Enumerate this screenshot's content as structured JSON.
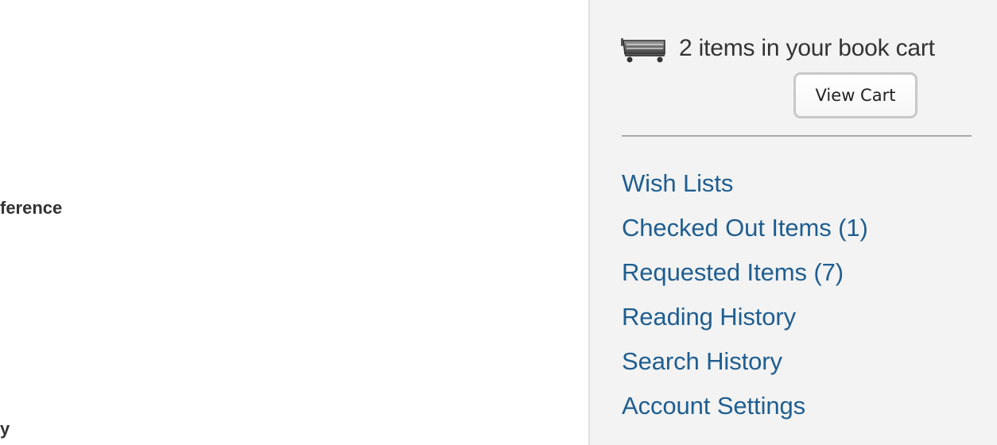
{
  "main": {
    "cutoff_label_1": "ference",
    "cutoff_label_2": "y"
  },
  "sidebar": {
    "cart_icon": "cart-icon",
    "cart_status": "2 items in your book cart",
    "view_cart_label": "View Cart",
    "links": [
      "Wish Lists",
      "Checked Out Items (1)",
      "Requested Items (7)",
      "Reading History",
      "Search History",
      "Account Settings"
    ]
  },
  "colors": {
    "link": "#1f5e91",
    "sidebar_bg": "#f3f3f3",
    "text": "#333333"
  }
}
